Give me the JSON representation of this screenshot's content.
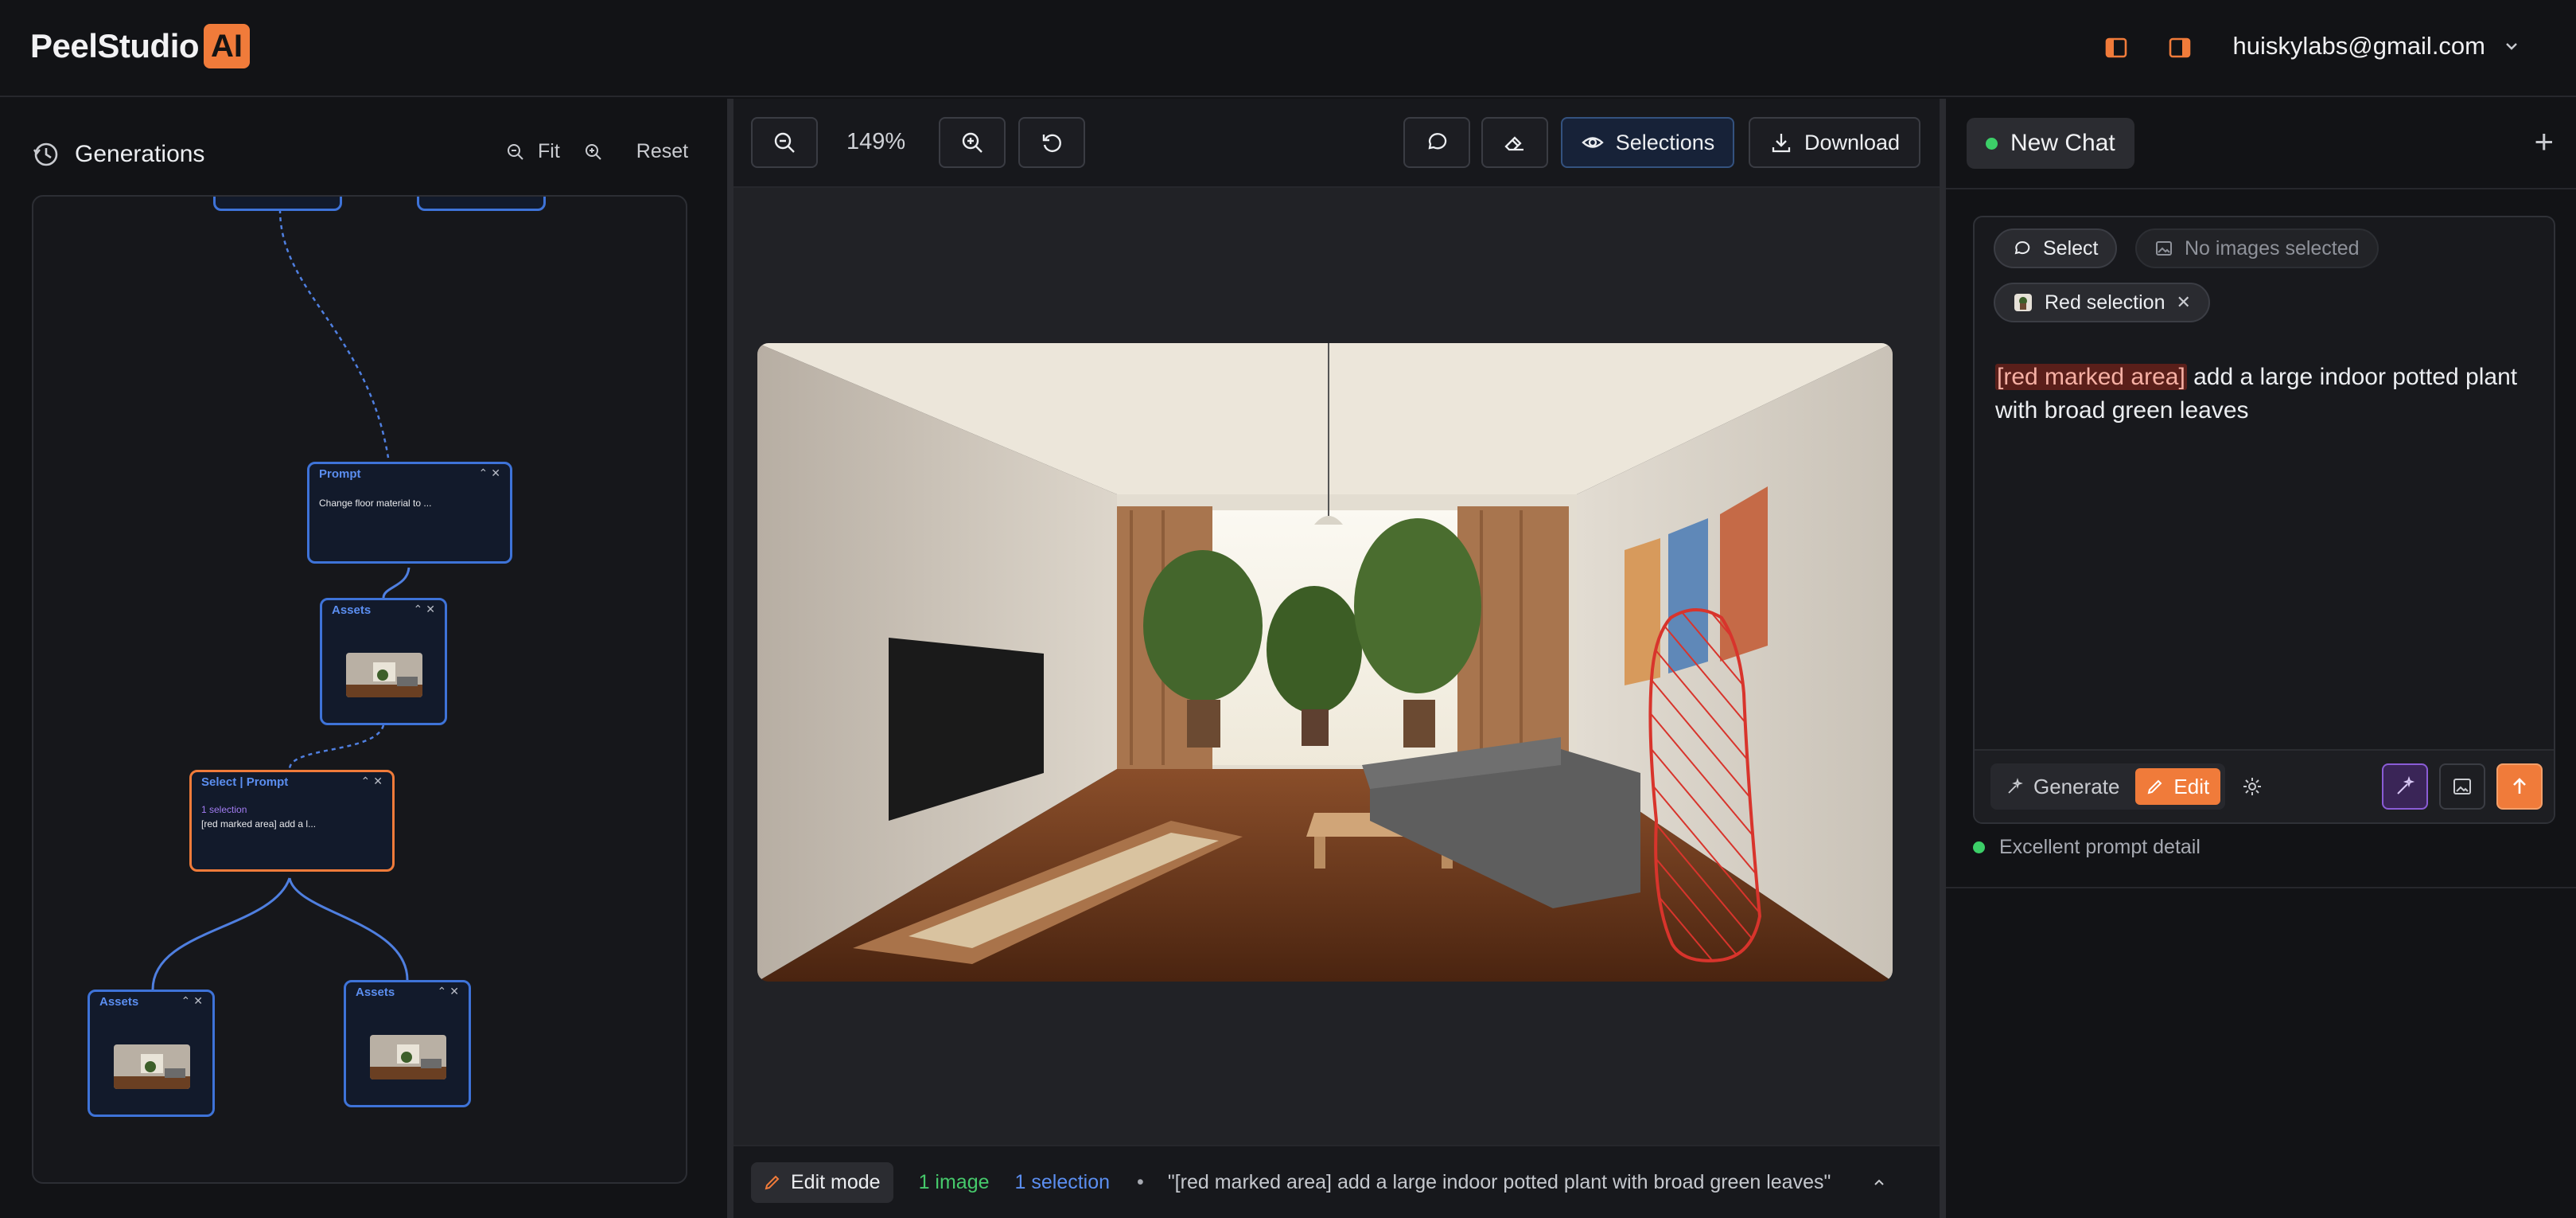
{
  "app": {
    "name": "PeelStudio",
    "badge": "AI"
  },
  "header": {
    "account_email": "huiskylabs@gmail.com"
  },
  "generations": {
    "title": "Generations",
    "zoom_controls": {
      "fit": "Fit",
      "reset": "Reset"
    },
    "nodes": {
      "prompt": {
        "header": "Prompt",
        "text": "Change floor material to ..."
      },
      "assets1": {
        "header": "Assets"
      },
      "select_prompt": {
        "header": "Select | Prompt",
        "selection": "1 selection",
        "text": "[red marked area] add a l..."
      },
      "assets2": {
        "header": "Assets"
      },
      "assets3": {
        "header": "Assets"
      }
    }
  },
  "viewer": {
    "zoom_level": "149%",
    "selections_label": "Selections",
    "download_label": "Download",
    "status": {
      "mode": "Edit mode",
      "images": "1 image",
      "selections": "1 selection",
      "bullet": "•",
      "prompt_preview": "\"[red marked area] add a large indoor potted plant with broad green leaves\""
    }
  },
  "chat": {
    "tab_title": "New Chat",
    "select_chip": "Select",
    "no_images_chip": "No images selected",
    "selection_chip": "Red selection",
    "prompt_highlight": "[red marked area]",
    "prompt_rest": " add a large indoor potted plant with broad green leaves",
    "modes": {
      "generate": "Generate",
      "edit": "Edit",
      "active": "Edit"
    },
    "quality_note": "Excellent prompt detail"
  },
  "colors": {
    "accent": "#f07b3a",
    "link_blue": "#5b8ef0",
    "selection_red": "#d8342c",
    "status_green": "#3ccf68"
  }
}
